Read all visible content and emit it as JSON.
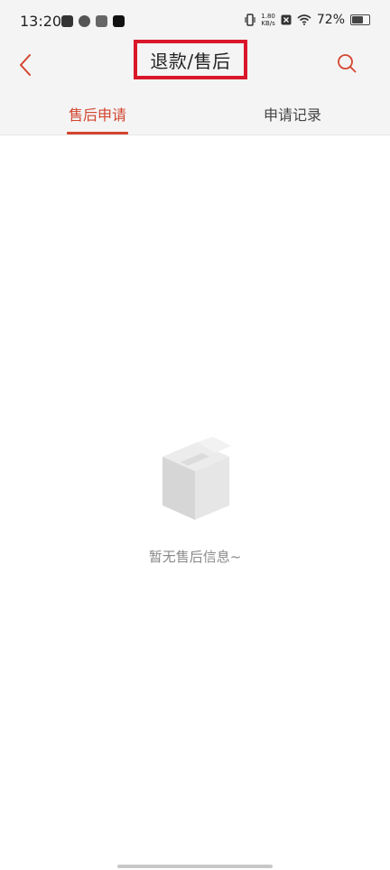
{
  "status_bar": {
    "time": "13:20",
    "net_speed_value": "1.80",
    "net_speed_unit": "KB/s",
    "battery": "72%",
    "battery_level": 0.72,
    "icons": [
      "notification-icon",
      "app-icon",
      "app-icon",
      "tiktok-icon",
      "vibrate-icon",
      "sim-icon",
      "wifi-icon",
      "battery-icon"
    ]
  },
  "app_bar": {
    "title": "退款/售后",
    "highlight_color": "#d9172a",
    "accent_color": "#d2452e"
  },
  "tabs": [
    {
      "label": "售后申请",
      "active": true
    },
    {
      "label": "申请记录",
      "active": false
    }
  ],
  "empty_state": {
    "message": "暂无售后信息~",
    "icon": "empty-box-icon"
  }
}
